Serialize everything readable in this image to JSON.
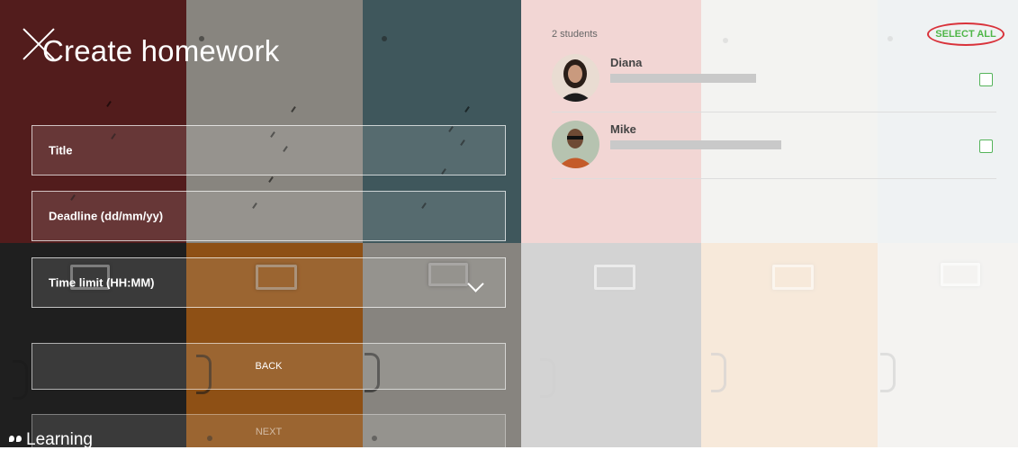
{
  "header": {
    "title": "Create homework"
  },
  "form": {
    "title_label": "Title",
    "deadline_label": "Deadline (dd/mm/yy)",
    "time_limit_label": "Time limit (HH:MM)",
    "back_label": "BACK",
    "next_label": "NEXT"
  },
  "brand": {
    "name": "Learning"
  },
  "students": {
    "count_label": "2 students",
    "select_all_label": "SELECT ALL",
    "items": [
      {
        "name": "Diana",
        "checked": false
      },
      {
        "name": "Mike",
        "checked": false
      }
    ]
  },
  "colors": {
    "accent_green": "#4fb648",
    "select_all_ring": "#d9323a",
    "checkbox_border": "#55b45a"
  },
  "icons": [
    "close-icon",
    "chevron-down-icon",
    "checkbox-icon",
    "brand-logo-icon"
  ]
}
